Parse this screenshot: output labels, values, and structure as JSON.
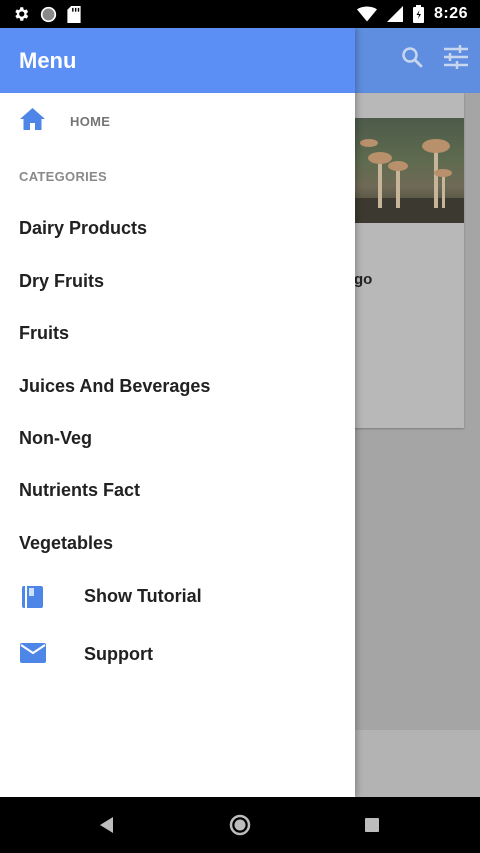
{
  "status_bar": {
    "time": "8:26"
  },
  "drawer": {
    "title": "Menu",
    "home_label": "HOME",
    "categories_header": "CATEGORIES",
    "categories": [
      "Dairy Products",
      "Dry Fruits",
      "Fruits",
      "Juices And Beverages",
      "Non-Veg",
      "Nutrients Fact",
      "Vegetables"
    ],
    "extra_items": [
      {
        "label": "Show Tutorial",
        "icon": "book-icon"
      },
      {
        "label": "Support",
        "icon": "mail-icon"
      }
    ]
  },
  "background": {
    "card_text_partial": "go"
  },
  "colors": {
    "accent": "#5b8ff5",
    "icon_blue": "#4e86e8"
  }
}
